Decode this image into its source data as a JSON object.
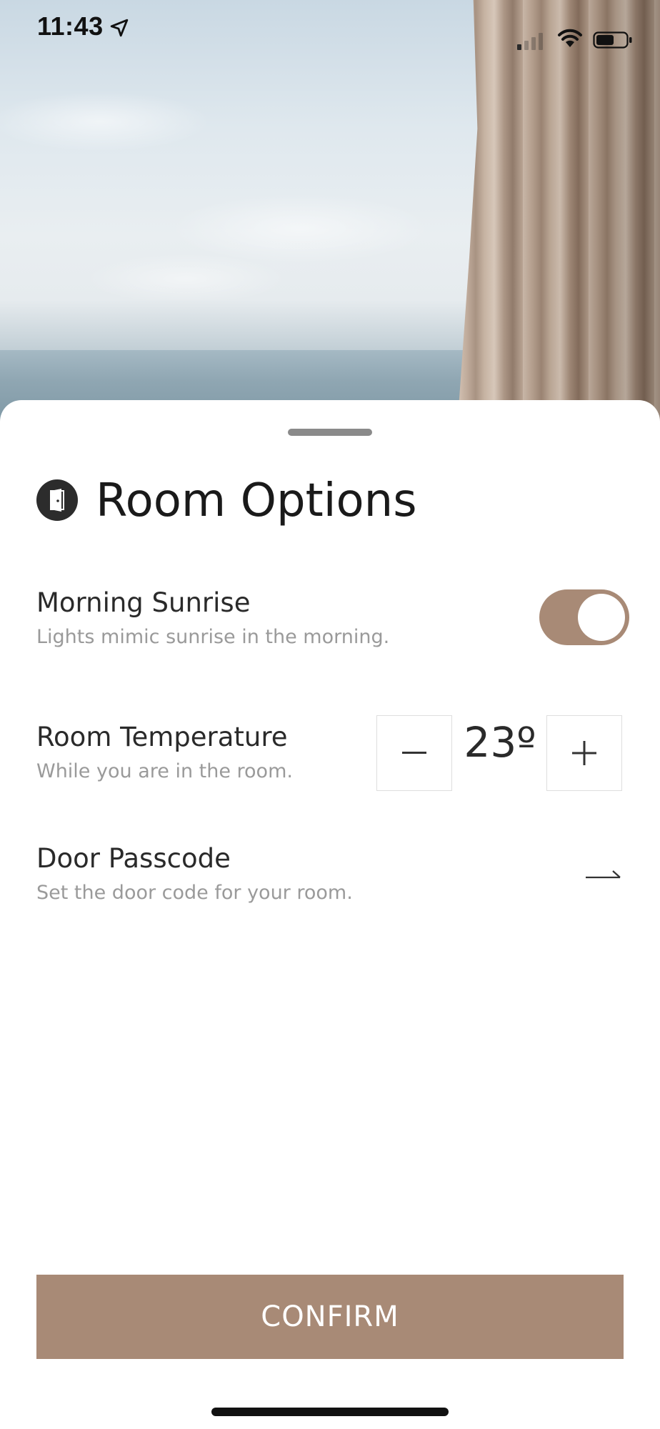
{
  "status_bar": {
    "time": "11:43",
    "location_icon": "location-arrow-icon",
    "signal_icon": "cellular-signal-icon",
    "wifi_icon": "wifi-icon",
    "battery_icon": "battery-icon"
  },
  "sheet": {
    "title": "Room Options",
    "title_icon": "door-icon",
    "options": [
      {
        "title": "Morning Sunrise",
        "subtitle": "Lights mimic sunrise in the morning.",
        "control": "toggle",
        "enabled": true
      },
      {
        "title": "Room Temperature",
        "subtitle": "While you are in the room.",
        "control": "stepper",
        "value": "23º",
        "decrement_label": "−",
        "increment_label": "+"
      },
      {
        "title": "Door Passcode",
        "subtitle": "Set the door code for your room.",
        "control": "arrow-right-icon"
      }
    ],
    "confirm_label": "CONFIRM"
  },
  "colors": {
    "accent": "#a88a76",
    "text_primary": "#2a2a2a",
    "text_secondary": "#9a9a9a",
    "background": "#ffffff"
  }
}
